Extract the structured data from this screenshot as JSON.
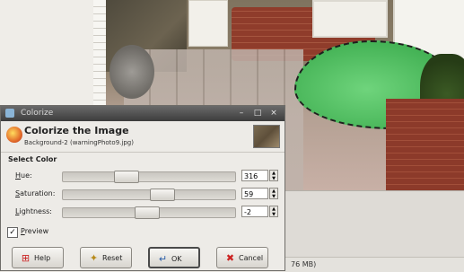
{
  "statusbar": {
    "text": "76 MB)"
  },
  "dialog": {
    "window_title": "Colorize",
    "wm_buttons": {
      "minimize": "–",
      "maximize": "□",
      "close": "×"
    },
    "header_title": "Colorize the Image",
    "header_subtitle": "Background-2 (warningPhoto9.jpg)",
    "section_label": "Select Color",
    "hue": {
      "label_u": "H",
      "label_rest": "ue:",
      "value": "316",
      "fraction": 0.35
    },
    "saturation": {
      "label_u": "S",
      "label_rest": "aturation:",
      "value": "59",
      "fraction": 0.59
    },
    "lightness": {
      "label_u": "L",
      "label_rest": "ightness:",
      "value": "-2",
      "fraction": 0.49
    },
    "preview": {
      "label_u": "P",
      "label_rest": "review",
      "checked": true
    },
    "buttons": {
      "help": "Help",
      "reset": "Reset",
      "ok": "OK",
      "cancel": "Cancel"
    }
  },
  "colors": {
    "selection_green": "#45b356",
    "titlebar": "#3c3c3c",
    "dialog_bg": "#edebe7"
  }
}
